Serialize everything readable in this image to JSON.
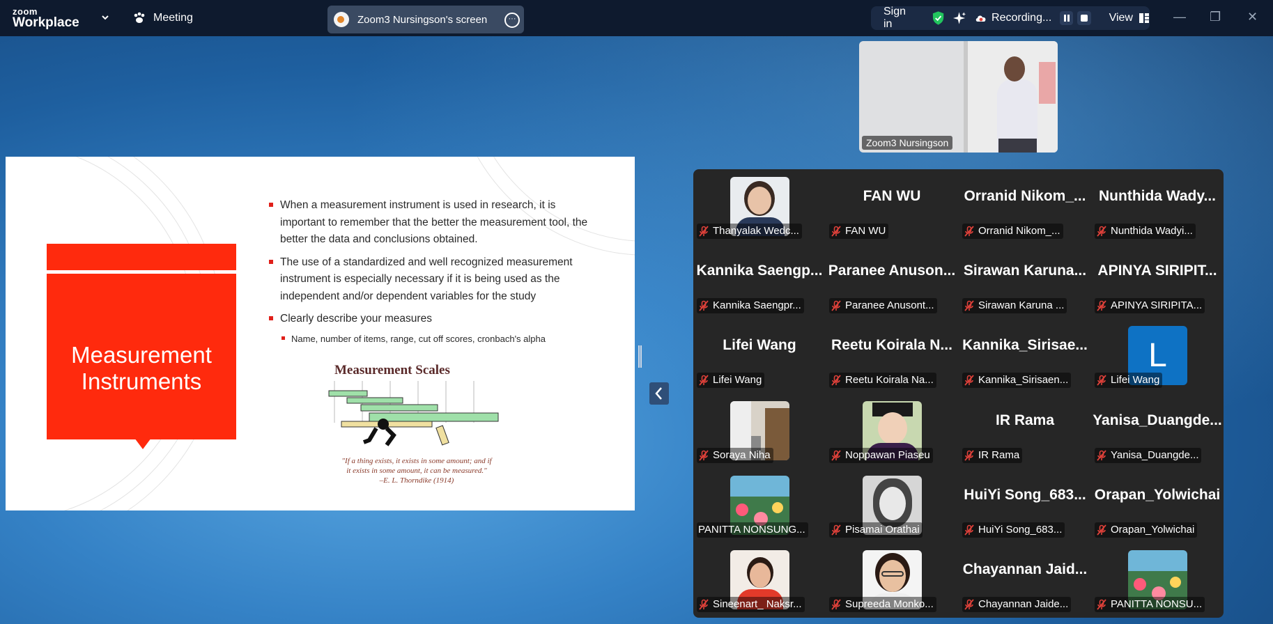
{
  "app": {
    "logo_top": "zoom",
    "logo_bottom": "Workplace",
    "meeting_label": "Meeting",
    "share_title": "Zoom3 Nursingson's screen",
    "sign_in": "Sign in",
    "recording": "Recording...",
    "view": "View"
  },
  "self_view": {
    "name": "Zoom3 Nursingson"
  },
  "slide": {
    "title": "Measurement Instruments",
    "bullets": [
      "When a measurement instrument is used in research, it is important to remember that the better the measurement tool, the better the data and conclusions obtained.",
      "The use of a standardized and well recognized measurement instrument is especially necessary if it is being used as the independent and/or dependent variables for the study",
      "Clearly describe your measures"
    ],
    "sub_bullet": "Name, number of items, range, cut off scores, cronbach's alpha",
    "scales_title": "Measurement Scales",
    "quote_line1": "\"If a thing exists, it exists in some amount; and if",
    "quote_line2": "it exists in some amount, it can be measured.\"",
    "quote_line3": "–E. L. Thorndike (1914)"
  },
  "participants": [
    {
      "big": "",
      "name": "Thanyalak Wedc...",
      "avatar": "photo-woman"
    },
    {
      "big": "FAN WU",
      "name": "FAN WU"
    },
    {
      "big": "Orranid Nikom_...",
      "name": "Orranid Nikom_..."
    },
    {
      "big": "Nunthida Wady...",
      "name": "Nunthida Wadyi..."
    },
    {
      "big": "Kannika Saengp...",
      "name": "Kannika Saengpr..."
    },
    {
      "big": "Paranee Anuson...",
      "name": "Paranee Anusont..."
    },
    {
      "big": "Sirawan Karuna...",
      "name": "Sirawan Karuna ..."
    },
    {
      "big": "APINYA SIRIPIT...",
      "name": "APINYA SIRIPITA..."
    },
    {
      "big": "Lifei Wang",
      "name": "Lifei Wang"
    },
    {
      "big": "Reetu Koirala N...",
      "name": "Reetu Koirala Na..."
    },
    {
      "big": "Kannika_Sirisae...",
      "name": "Kannika_Sirisaen..."
    },
    {
      "big": "",
      "name": "Lifei Wang",
      "avatar": "letter-L",
      "letter": "L"
    },
    {
      "big": "",
      "name": "Soraya Niha",
      "avatar": "photo-room"
    },
    {
      "big": "",
      "name": "Noppawan Piaseu",
      "avatar": "photo-grad"
    },
    {
      "big": "IR Rama",
      "name": "IR Rama"
    },
    {
      "big": "Yanisa_Duangde...",
      "name": "Yanisa_Duangde..."
    },
    {
      "big": "",
      "name": "PANITTA NONSUNG...",
      "avatar": "flowers",
      "no_mic": true
    },
    {
      "big": "",
      "name": "Pisamai Orathai",
      "avatar": "sketch"
    },
    {
      "big": "HuiYi Song_683...",
      "name": "HuiYi Song_683..."
    },
    {
      "big": "Orapan_Yolwichai",
      "name": "Orapan_Yolwichai"
    },
    {
      "big": "",
      "name": "Sineenart_ Naksr...",
      "avatar": "photo-red"
    },
    {
      "big": "",
      "name": "Supreeda Monko...",
      "avatar": "photo-glasses"
    },
    {
      "big": "Chayannan Jaid...",
      "name": "Chayannan Jaide..."
    },
    {
      "big": "",
      "name": "PANITTA NONSU...",
      "avatar": "flowers"
    }
  ],
  "colors": {
    "slide_red": "#ff2a0d",
    "muted_mic": "#e0413a",
    "shield": "#22c55e"
  }
}
